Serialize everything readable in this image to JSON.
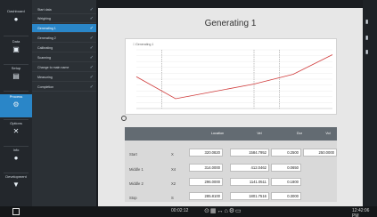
{
  "rail": {
    "items": [
      {
        "label": "Dashboard",
        "icon": "dashboard-icon"
      },
      {
        "label": "Data",
        "icon": "data-icon"
      },
      {
        "label": "Setup",
        "icon": "setup-icon"
      },
      {
        "label": "Process",
        "icon": "process-icon"
      },
      {
        "label": "Options",
        "icon": "options-icon"
      },
      {
        "label": "Info",
        "icon": "info-icon"
      },
      {
        "label": "Development",
        "icon": "development-icon"
      }
    ]
  },
  "steps": [
    "Start data",
    "Weighing",
    "Generating 1",
    "Generating 2",
    "Calibrating",
    "Scanning",
    "Change to main name",
    "Measuring",
    "Completion"
  ],
  "main": {
    "title": "Generating 1",
    "legend": "Generating 1"
  },
  "table": {
    "headers": [
      "Location",
      "Vel",
      "Dur",
      "Vol"
    ],
    "rows": [
      {
        "label": "Start",
        "code": "X",
        "values": [
          "320.0820",
          "1584.7952",
          "0.2500",
          "250.0000"
        ]
      },
      {
        "label": "Middle 1",
        "code": "X4",
        "values": [
          "314.0000",
          "412.0462",
          "0.0650",
          ""
        ]
      },
      {
        "label": "Middle 2",
        "code": "X2",
        "values": [
          "296.0000",
          "1141.0511",
          "0.1800",
          ""
        ]
      },
      {
        "label": "Stop",
        "code": "S",
        "values": [
          "285.8100",
          "1801.7516",
          "0.3000",
          ""
        ]
      }
    ]
  },
  "taskbar": {
    "time": "00:02:12",
    "clock": "12:42:06 PM"
  },
  "chart_data": {
    "type": "line",
    "x": [
      0,
      20,
      40,
      60,
      80,
      100
    ],
    "y": [
      5,
      -40,
      -25,
      -10,
      10,
      50
    ],
    "ylim": [
      -60,
      60
    ],
    "xlim": [
      0,
      100
    ]
  }
}
